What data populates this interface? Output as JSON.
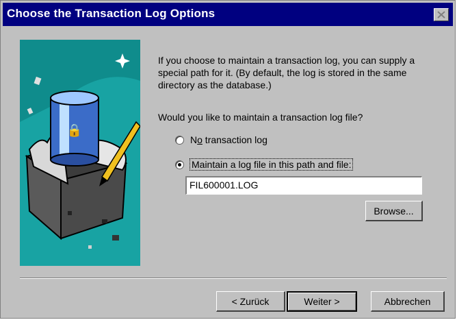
{
  "window": {
    "title": "Choose the Transaction Log Options",
    "close_glyph": "✕"
  },
  "info": {
    "description": "If you choose to maintain a transaction log, you can supply a special path for it.  (By default, the log is stored in the same directory as the database.)",
    "question": "Would you like to maintain a transaction log file?"
  },
  "options": [
    {
      "label": "No transaction log",
      "mnemonic": "o",
      "checked": false
    },
    {
      "label": "Maintain a log file in this path and file:",
      "mnemonic": "M",
      "checked": true
    }
  ],
  "path_field": {
    "value": "FIL600001.LOG"
  },
  "buttons": {
    "browse": "Browse...",
    "back": "< Zurück",
    "next": "Weiter >",
    "cancel": "Abbrechen"
  },
  "icons": {
    "illustration": "database-cylinder-in-box-icon",
    "close": "close-icon"
  },
  "colors": {
    "titlebar": "#000080",
    "face": "#c0c0c0",
    "illustration_bg": "#18a3a3"
  }
}
